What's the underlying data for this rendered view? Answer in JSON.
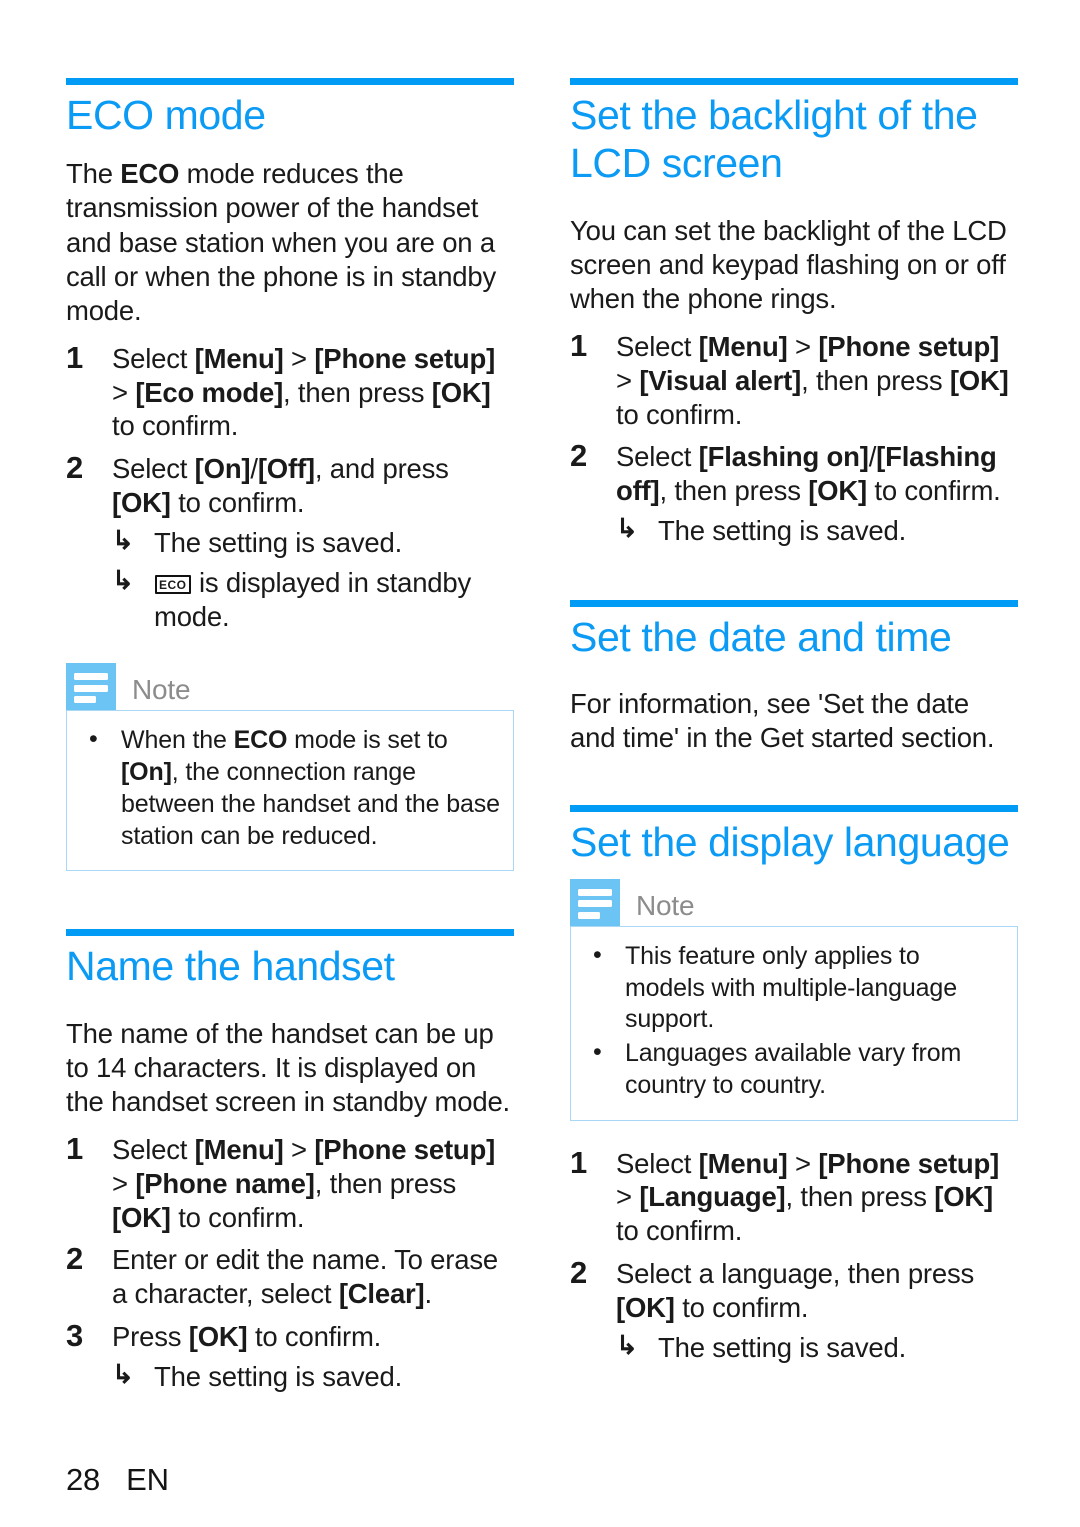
{
  "footer": {
    "page_number": "28",
    "language_code": "EN"
  },
  "colors": {
    "heading_blue": "#0b9bf5",
    "rule_blue": "#009bf5",
    "note_icon_blue": "#6cc4f4",
    "note_border_blue": "#a8d8f5",
    "note_title_gray": "#8c8c8c",
    "body_text": "#1a1a1a"
  },
  "left_column": {
    "sections": [
      {
        "heading": "ECO mode",
        "intro": "The ECO mode reduces the transmission power of the handset and base station when you are on a call or when the phone is in standby mode.",
        "intro_parts": {
          "before": "The ",
          "bold": "ECO",
          "after": " mode reduces the transmission power of the handset and base station when you are on a call or when the phone is in standby mode."
        },
        "steps": [
          {
            "number": "1",
            "text": "Select [Menu] > [Phone setup] > [Eco mode], then press [OK] to confirm.",
            "segments": [
              {
                "t": "Select ",
                "bold": false
              },
              {
                "t": "[Menu]",
                "bold": true
              },
              {
                "t": " > ",
                "bold": false
              },
              {
                "t": "[Phone setup]",
                "bold": true
              },
              {
                "t": " > ",
                "bold": false
              },
              {
                "t": "[Eco mode]",
                "bold": true
              },
              {
                "t": ", then press ",
                "bold": false
              },
              {
                "t": "[OK]",
                "bold": true
              },
              {
                "t": " to confirm.",
                "bold": false
              }
            ],
            "results": []
          },
          {
            "number": "2",
            "text": "Select [On]/[Off], and press [OK] to confirm.",
            "segments": [
              {
                "t": "Select ",
                "bold": false
              },
              {
                "t": "[On]",
                "bold": true
              },
              {
                "t": "/",
                "bold": false
              },
              {
                "t": "[Off]",
                "bold": true
              },
              {
                "t": ", and press ",
                "bold": false
              },
              {
                "t": "[OK]",
                "bold": true
              },
              {
                "t": " to confirm.",
                "bold": false
              }
            ],
            "results": [
              "The setting is saved.",
              "ECO is displayed in standby mode."
            ]
          }
        ],
        "note": {
          "title": "Note",
          "items": [
            "When the ECO mode is set to [On], the connection range between the handset and the base station can be reduced."
          ]
        }
      },
      {
        "heading": "Name the handset",
        "intro": "The name of the handset can be up to 14 characters. It is displayed on the handset screen in standby mode.",
        "steps": [
          {
            "number": "1",
            "text": "Select [Menu] > [Phone setup] > [Phone name], then press [OK] to confirm.",
            "segments": [
              {
                "t": "Select ",
                "bold": false
              },
              {
                "t": "[Menu]",
                "bold": true
              },
              {
                "t": " > ",
                "bold": false
              },
              {
                "t": "[Phone setup]",
                "bold": true
              },
              {
                "t": " > ",
                "bold": false
              },
              {
                "t": "[Phone name]",
                "bold": true
              },
              {
                "t": ", then press ",
                "bold": false
              },
              {
                "t": "[OK]",
                "bold": true
              },
              {
                "t": " to confirm.",
                "bold": false
              }
            ],
            "results": []
          },
          {
            "number": "2",
            "text": "Enter or edit the name. To erase a character, select [Clear].",
            "segments": [
              {
                "t": "Enter or edit the name. To erase a character, select ",
                "bold": false
              },
              {
                "t": "[Clear]",
                "bold": true
              },
              {
                "t": ".",
                "bold": false
              }
            ],
            "results": []
          },
          {
            "number": "3",
            "text": "Press [OK] to confirm.",
            "segments": [
              {
                "t": "Press ",
                "bold": false
              },
              {
                "t": "[OK]",
                "bold": true
              },
              {
                "t": " to confirm.",
                "bold": false
              }
            ],
            "results": [
              "The setting is saved."
            ]
          }
        ]
      }
    ]
  },
  "right_column": {
    "sections": [
      {
        "heading": "Set the backlight of the LCD screen",
        "intro": "You can set the backlight of the LCD screen and keypad flashing on or off when the phone rings.",
        "steps": [
          {
            "number": "1",
            "text": "Select [Menu] > [Phone setup] > [Visual alert], then press [OK] to confirm.",
            "segments": [
              {
                "t": "Select ",
                "bold": false
              },
              {
                "t": "[Menu]",
                "bold": true
              },
              {
                "t": " > ",
                "bold": false
              },
              {
                "t": "[Phone setup]",
                "bold": true
              },
              {
                "t": " > ",
                "bold": false
              },
              {
                "t": "[Visual alert]",
                "bold": true
              },
              {
                "t": ", then press ",
                "bold": false
              },
              {
                "t": "[OK]",
                "bold": true
              },
              {
                "t": " to confirm.",
                "bold": false
              }
            ],
            "results": []
          },
          {
            "number": "2",
            "text": "Select [Flashing on]/[Flashing off], then press [OK] to confirm.",
            "segments": [
              {
                "t": "Select ",
                "bold": false
              },
              {
                "t": "[Flashing on]",
                "bold": true
              },
              {
                "t": "/",
                "bold": false
              },
              {
                "t": "[Flashing off]",
                "bold": true
              },
              {
                "t": ", then press ",
                "bold": false
              },
              {
                "t": "[OK]",
                "bold": true
              },
              {
                "t": " to confirm.",
                "bold": false
              }
            ],
            "results": [
              "The setting is saved."
            ]
          }
        ]
      },
      {
        "heading": "Set the date and time",
        "intro": "For information, see 'Set the date and time' in the Get started section.",
        "steps": []
      },
      {
        "heading": "Set the display language",
        "note": {
          "title": "Note",
          "items": [
            "This feature only applies to models with multiple-language support.",
            "Languages available vary from country to country."
          ]
        },
        "steps": [
          {
            "number": "1",
            "text": "Select [Menu] > [Phone setup] > [Language], then press [OK] to confirm.",
            "segments": [
              {
                "t": "Select ",
                "bold": false
              },
              {
                "t": "[Menu]",
                "bold": true
              },
              {
                "t": " > ",
                "bold": false
              },
              {
                "t": "[Phone setup]",
                "bold": true
              },
              {
                "t": " > ",
                "bold": false
              },
              {
                "t": "[Language]",
                "bold": true
              },
              {
                "t": ", then press ",
                "bold": false
              },
              {
                "t": "[OK]",
                "bold": true
              },
              {
                "t": " to confirm.",
                "bold": false
              }
            ],
            "results": []
          },
          {
            "number": "2",
            "text": "Select a language, then press [OK] to confirm.",
            "segments": [
              {
                "t": "Select a language, then press ",
                "bold": false
              },
              {
                "t": "[OK]",
                "bold": true
              },
              {
                "t": " to confirm.",
                "bold": false
              }
            ],
            "results": [
              "The setting is saved."
            ]
          }
        ]
      }
    ]
  },
  "glyphs": {
    "result_arrow": "↳",
    "bullet": "•",
    "eco_badge_text": "ECO"
  }
}
